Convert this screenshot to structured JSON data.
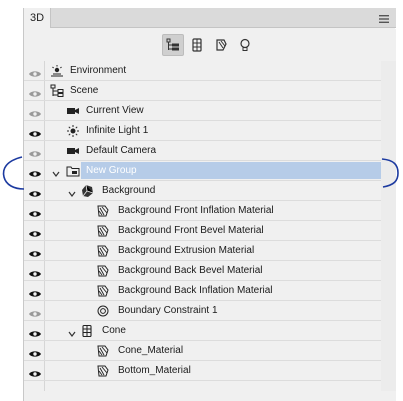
{
  "panel": {
    "tab_label": "3D",
    "menu_icon": "hamburger-icon"
  },
  "toolbar": {
    "buttons": [
      {
        "icon": "scene-filter-icon",
        "active": true
      },
      {
        "icon": "mesh-filter-icon",
        "active": false
      },
      {
        "icon": "material-filter-icon",
        "active": false
      },
      {
        "icon": "light-filter-icon",
        "active": false
      }
    ]
  },
  "layers": [
    {
      "label": "Environment",
      "icon": "environment-icon",
      "eye": "dim"
    },
    {
      "label": "Scene",
      "icon": "scene-icon",
      "eye": "dim"
    },
    {
      "label": "Current View",
      "icon": "camera-icon",
      "eye": "dim"
    },
    {
      "label": "Infinite Light 1",
      "icon": "light-icon",
      "eye": "on"
    },
    {
      "label": "Default Camera",
      "icon": "camera-icon",
      "eye": "dim"
    },
    {
      "label": "New Group",
      "icon": "group-icon",
      "eye": "on",
      "selected": true,
      "expanded": true
    },
    {
      "label": "Background",
      "icon": "mesh-icon",
      "eye": "on",
      "expanded": true
    },
    {
      "label": "Background Front Inflation Material",
      "icon": "material-icon",
      "eye": "on"
    },
    {
      "label": "Background Front Bevel Material",
      "icon": "material-icon",
      "eye": "on"
    },
    {
      "label": "Background Extrusion Material",
      "icon": "material-icon",
      "eye": "on"
    },
    {
      "label": "Background Back Bevel Material",
      "icon": "material-icon",
      "eye": "on"
    },
    {
      "label": "Background Back Inflation Material",
      "icon": "material-icon",
      "eye": "on"
    },
    {
      "label": "Boundary Constraint 1",
      "icon": "constraint-icon",
      "eye": "dim"
    },
    {
      "label": "Cone",
      "icon": "cone-mesh-icon",
      "eye": "on",
      "expanded": true
    },
    {
      "label": "Cone_Material",
      "icon": "material-icon",
      "eye": "on"
    },
    {
      "label": "Bottom_Material",
      "icon": "material-icon",
      "eye": "on"
    }
  ],
  "colors": {
    "selection": "#b6cce8",
    "annotation": "#1c3aa0"
  }
}
